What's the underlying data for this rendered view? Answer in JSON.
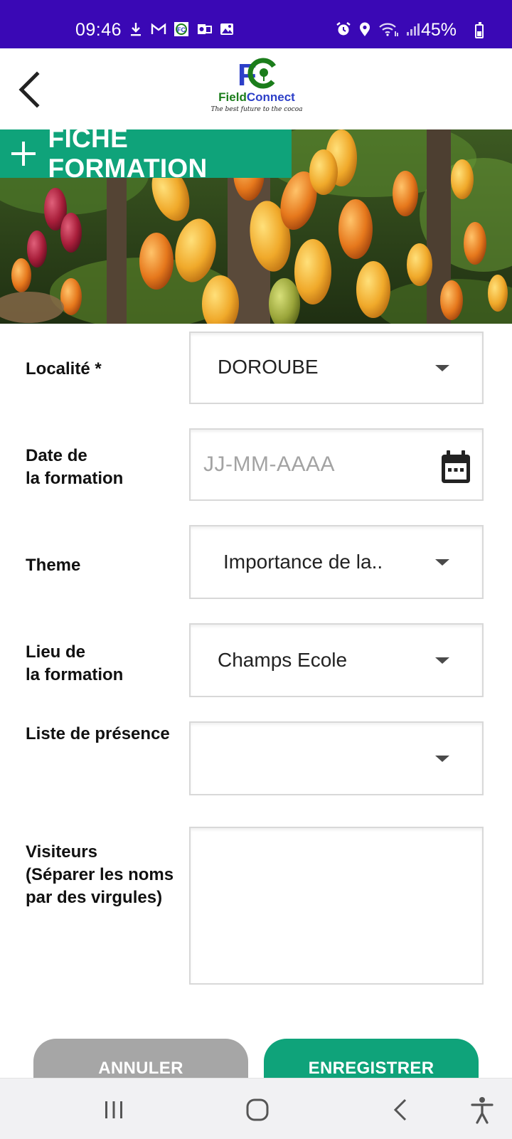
{
  "status_bar": {
    "time": "09:46",
    "battery_percent": "45%",
    "battery_level": 0.45,
    "notification_icons": [
      "download-icon",
      "gmail-icon",
      "fieldconnect-app-icon",
      "outlook-icon",
      "gallery-icon"
    ],
    "system_icons": [
      "alarm-icon",
      "location-icon",
      "wifi-icon",
      "signal-icon",
      "battery-icon"
    ]
  },
  "header": {
    "back_icon": "chevron-left-icon",
    "logo": {
      "initials": "FC",
      "name_part1": "Field",
      "name_part2": "Connect",
      "tagline": "The best future to the cocoa"
    }
  },
  "banner": {
    "icon": "plus-icon",
    "title": "FICHE FORMATION"
  },
  "form": {
    "localite": {
      "label": "Localité *",
      "value": "DOROUBE"
    },
    "date": {
      "label_line1": "Date de",
      "label_line2": "la formation",
      "placeholder": "JJ-MM-AAAA",
      "icon": "calendar-icon"
    },
    "theme": {
      "label": "Theme",
      "value": "Importance de la.."
    },
    "lieu": {
      "label_line1": "Lieu de",
      "label_line2": "la formation",
      "value": "Champs Ecole"
    },
    "presence": {
      "label": "Liste de présence",
      "value": ""
    },
    "visiteurs": {
      "label_line1": "Visiteurs",
      "label_line2": "(Séparer les noms",
      "label_line3": "par des virgules)",
      "value": ""
    }
  },
  "actions": {
    "cancel_label": "ANNULER",
    "save_label": "ENREGISTRER"
  },
  "nav_bar": {
    "icons": [
      "recent-apps-icon",
      "home-icon",
      "back-icon",
      "accessibility-icon"
    ]
  },
  "colors": {
    "status_bar": "#3a08b5",
    "accent_green": "#0fa37a",
    "cancel_gray": "#a6a6a6",
    "logo_blue": "#2c3fc8",
    "logo_green": "#1b7d1b"
  }
}
